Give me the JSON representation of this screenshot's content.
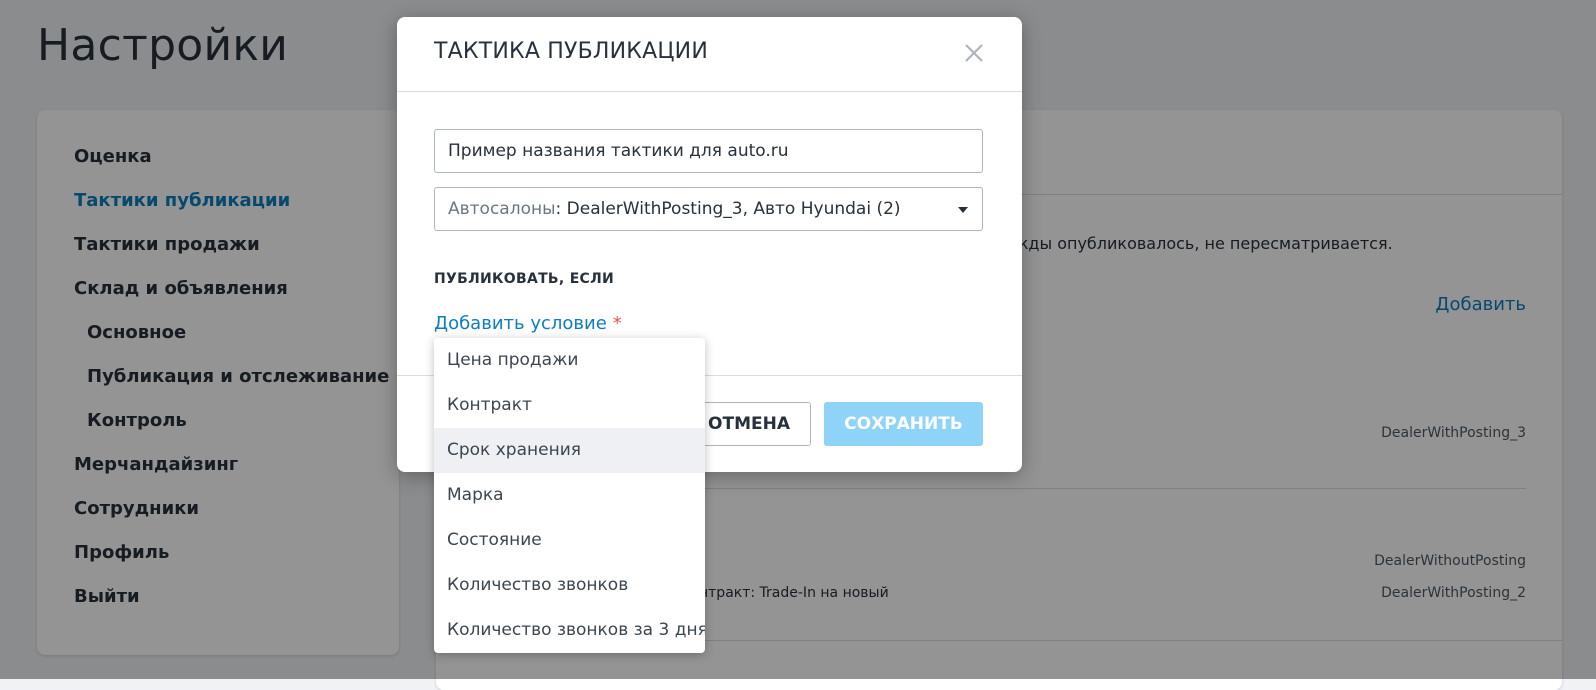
{
  "page": {
    "title": "Настройки"
  },
  "sidebar": {
    "items": [
      {
        "label": "Оценка",
        "active": false,
        "sub": false
      },
      {
        "label": "Тактики публикации",
        "active": true,
        "sub": false
      },
      {
        "label": "Тактики продажи",
        "active": false,
        "sub": false
      },
      {
        "label": "Склад и объявления",
        "active": false,
        "sub": false
      },
      {
        "label": "Основное",
        "active": false,
        "sub": true
      },
      {
        "label": "Публикация и отслеживание",
        "active": false,
        "sub": true
      },
      {
        "label": "Контроль",
        "active": false,
        "sub": true
      },
      {
        "label": "Мерчандайзинг",
        "active": false,
        "sub": false
      },
      {
        "label": "Сотрудники",
        "active": false,
        "sub": false
      },
      {
        "label": "Профиль",
        "active": false,
        "sub": false
      },
      {
        "label": "Выйти",
        "active": false,
        "sub": false
      }
    ]
  },
  "content": {
    "description_tail": "жды опубликовалось, не пересматривается.",
    "add_link": "Добавить",
    "row1_dealer": "DealerWithPosting_3",
    "row2_dealer_a": "DealerWithoutPosting",
    "row2_dealer_b": "DealerWithPosting_2",
    "row2_condition_tail": "нтракт: Trade-In на новый"
  },
  "modal": {
    "title": "ТАКТИКА ПУБЛИКАЦИИ",
    "name_input_value": "Пример названия тактики для auto.ru",
    "dealers_label": "Автосалоны",
    "dealers_value": ": DealerWithPosting_3, Авто Hyundai (2)",
    "section_label": "ПУБЛИКОВАТЬ, ЕСЛИ",
    "add_condition": "Добавить условие",
    "required_mark": "*",
    "cancel_label": "ОТМЕНА",
    "save_label": "СОХРАНИТЬ"
  },
  "dropdown": {
    "items": [
      "Цена продажи",
      "Контракт",
      "Срок хранения",
      "Марка",
      "Состояние",
      "Количество звонков",
      "Количество звонков за 3 дня"
    ],
    "hovered_index": 2
  },
  "colors": {
    "accent": "#0b7ec0",
    "save_disabled": "#8fd3f8",
    "required": "#e8554e"
  }
}
